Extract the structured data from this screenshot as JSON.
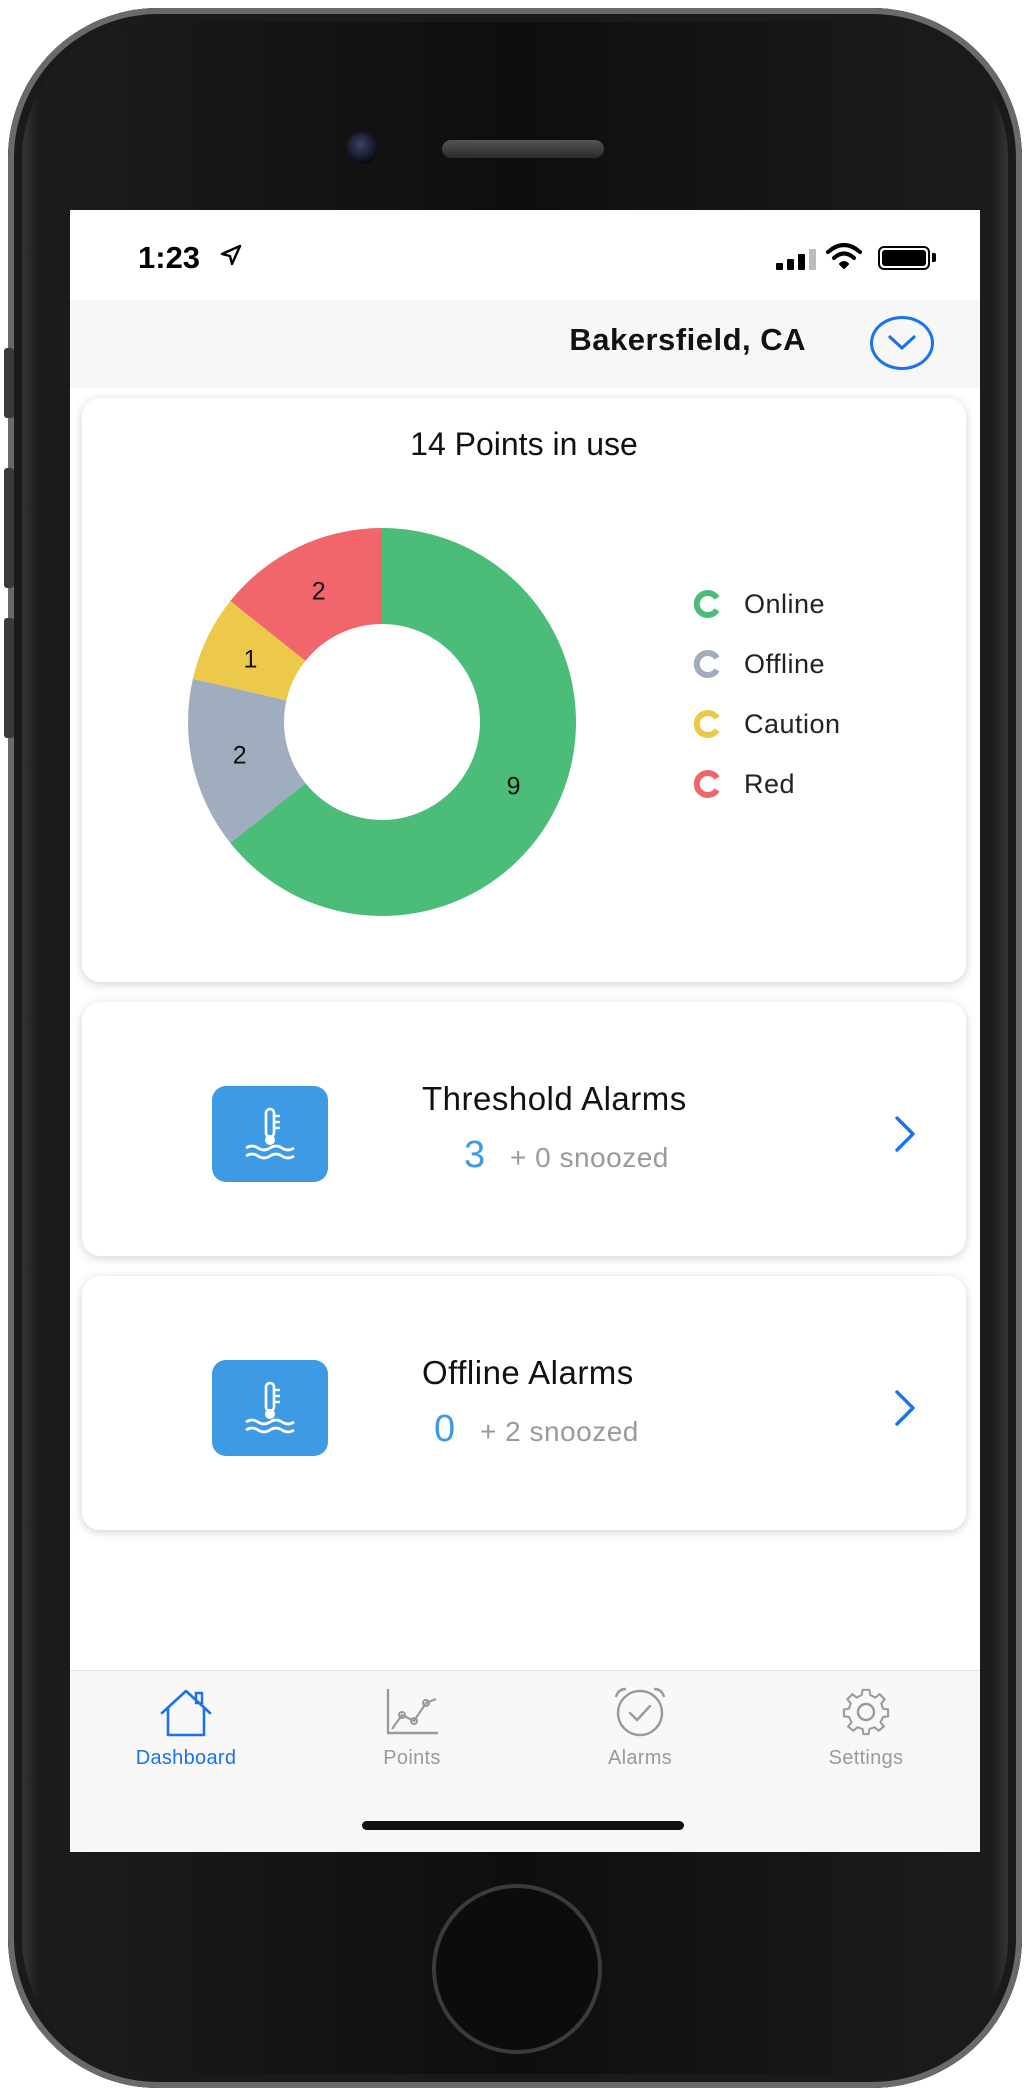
{
  "status_bar": {
    "time": "1:23"
  },
  "header": {
    "location": "Bakersfield, CA"
  },
  "chart_card": {
    "title": "14 Points in use",
    "legend": [
      {
        "label": "Online",
        "color": "#4bbd78"
      },
      {
        "label": "Offline",
        "color": "#a0adbe"
      },
      {
        "label": "Caution",
        "color": "#ecc94b"
      },
      {
        "label": "Red",
        "color": "#f0666a"
      }
    ]
  },
  "chart_data": {
    "type": "pie",
    "title": "14 Points in use",
    "categories": [
      "Online",
      "Offline",
      "Caution",
      "Red"
    ],
    "values": [
      9,
      2,
      1,
      2
    ],
    "colors": [
      "#4bbd78",
      "#a0adbe",
      "#ecc94b",
      "#f0666a"
    ],
    "donut": true,
    "legend": "right"
  },
  "alarms": [
    {
      "title": "Threshold Alarms",
      "count": "3",
      "snoozed": "+ 0 snoozed",
      "icon": "thermometer-water-icon"
    },
    {
      "title": "Offline Alarms",
      "count": "0",
      "snoozed": "+ 2 snoozed",
      "icon": "thermometer-water-icon"
    }
  ],
  "tabbar": {
    "items": [
      {
        "label": "Dashboard",
        "icon": "house-icon",
        "active": true
      },
      {
        "label": "Points",
        "icon": "line-chart-icon",
        "active": false
      },
      {
        "label": "Alarms",
        "icon": "alarm-clock-icon",
        "active": false
      },
      {
        "label": "Settings",
        "icon": "gear-icon",
        "active": false
      }
    ],
    "active_color": "#1a73e8",
    "inactive_color": "#9a9a9a"
  }
}
